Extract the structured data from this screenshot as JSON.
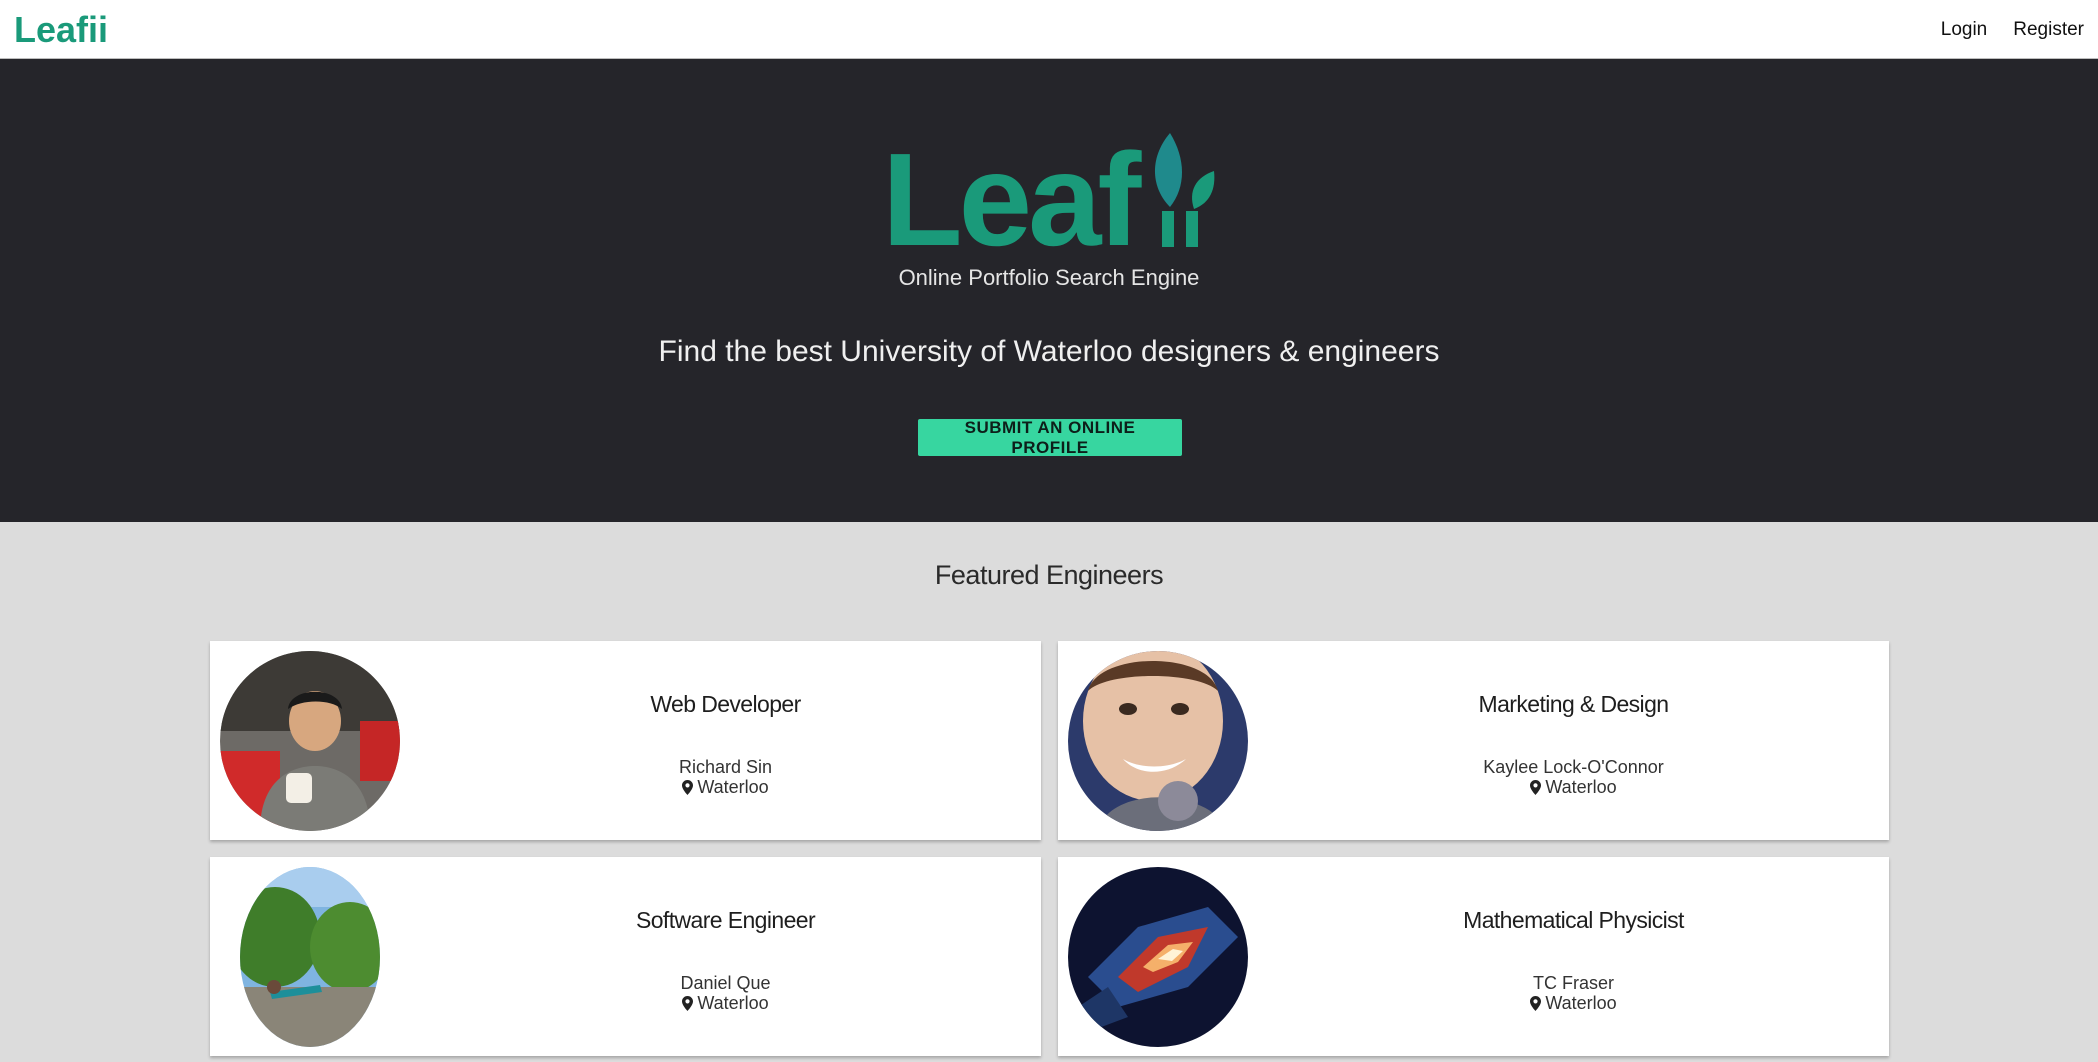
{
  "nav": {
    "logo_text": "Leafii",
    "links": [
      "Login",
      "Register"
    ]
  },
  "hero": {
    "logo_text": "Leafii",
    "subtitle": "Online Portfolio Search Engine",
    "tagline": "Find the best University of Waterloo designers & engineers",
    "cta_label": "SUBMIT AN ONLINE PROFILE"
  },
  "featured": {
    "title": "Featured Engineers",
    "cards": [
      {
        "role": "Web Developer",
        "name": "Richard Sin",
        "location": "Waterloo"
      },
      {
        "role": "Marketing & Design",
        "name": "Kaylee Lock-O'Connor",
        "location": "Waterloo"
      },
      {
        "role": "Software Engineer",
        "name": "Daniel Que",
        "location": "Waterloo"
      },
      {
        "role": "Mathematical Physicist",
        "name": "TC Fraser",
        "location": "Waterloo"
      }
    ]
  },
  "colors": {
    "brand_green": "#1a9a7a",
    "cta_green": "#37d6a0",
    "hero_bg": "#25252a",
    "section_bg": "#dcdcdc"
  },
  "icons": [
    "leaf-logo-icon",
    "map-pin-icon"
  ]
}
